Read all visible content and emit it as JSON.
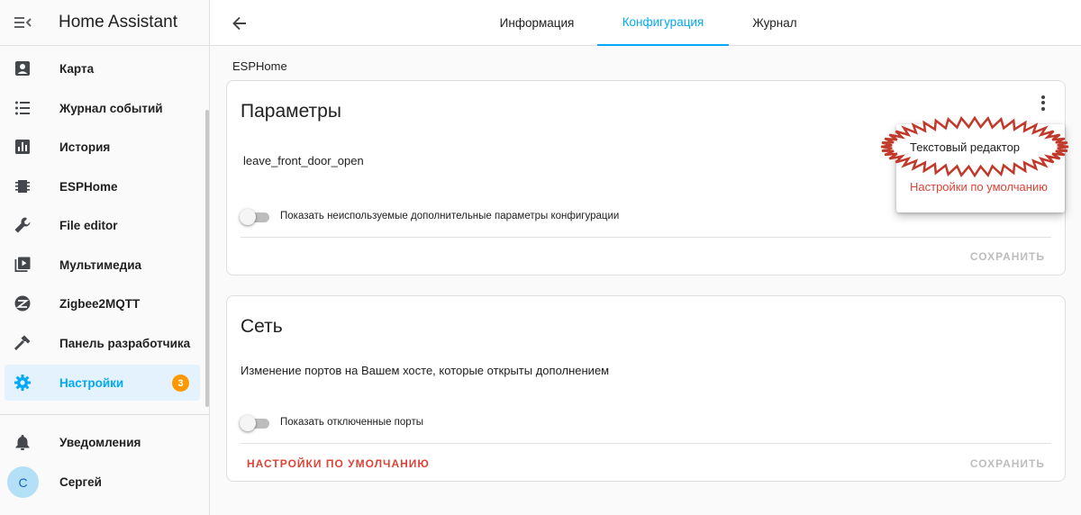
{
  "app": {
    "title": "Home Assistant"
  },
  "sidebar": {
    "items": [
      {
        "label": "Карта",
        "icon": "map-account-icon"
      },
      {
        "label": "Журнал событий",
        "icon": "format-list-bulleted-icon"
      },
      {
        "label": "История",
        "icon": "chart-box-icon"
      },
      {
        "label": "ESPHome",
        "icon": "chip-icon"
      },
      {
        "label": "File editor",
        "icon": "wrench-icon"
      },
      {
        "label": "Мультимедиа",
        "icon": "play-box-multiple-icon"
      },
      {
        "label": "Zigbee2MQTT",
        "icon": "zigbee-icon"
      },
      {
        "label": "Панель разработчика",
        "icon": "hammer-icon"
      },
      {
        "label": "Настройки",
        "icon": "cog-icon",
        "active": true,
        "badge": "3"
      }
    ],
    "notifications": {
      "label": "Уведомления",
      "icon": "bell-icon"
    },
    "user": {
      "label": "Сергей",
      "initial": "С"
    },
    "accent_color": "#03a9f4",
    "badge_color": "#ff9800"
  },
  "tabs": [
    {
      "label": "Информация"
    },
    {
      "label": "Конфигурация",
      "active": true
    },
    {
      "label": "Журнал"
    }
  ],
  "breadcrumb": "ESPHome",
  "options_card": {
    "title": "Параметры",
    "value": "leave_front_door_open",
    "toggle_label": "Показать неиспользуемые дополнительные параметры конфигурации",
    "toggle_on": false,
    "save_label": "СОХРАНИТЬ"
  },
  "menu": {
    "items": [
      {
        "label": "Текстовый редактор"
      },
      {
        "label": "Настройки по умолчанию",
        "color": "#db4437"
      }
    ]
  },
  "network_card": {
    "title": "Сеть",
    "description": "Изменение портов на Вашем хосте, которые открыты дополнением",
    "toggle_label": "Показать отключенные порты",
    "toggle_on": false,
    "reset_label": "НАСТРОЙКИ ПО УМОЛЧАНИЮ",
    "save_label": "СОХРАНИТЬ"
  }
}
